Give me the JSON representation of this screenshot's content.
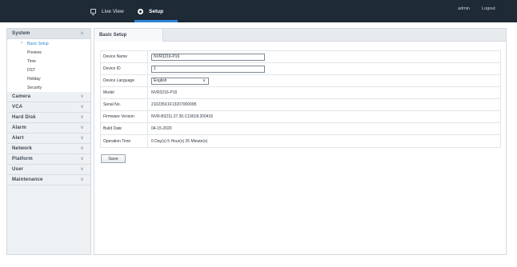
{
  "topbar": {
    "live_view_label": "Live View",
    "setup_label": "Setup",
    "admin_label": "admin",
    "logout_label": "Logout",
    "accent_color": "#2f86d8"
  },
  "sidebar": {
    "system_label": "System",
    "system_subitems": [
      "Basic Setup",
      "Preview",
      "Time",
      "DST",
      "Holiday",
      "Security"
    ],
    "groups": [
      "Camera",
      "VCA",
      "Hard Disk",
      "Alarm",
      "Alert",
      "Network",
      "Platform",
      "User",
      "Maintenance"
    ]
  },
  "main": {
    "tab_label": "Basic Setup",
    "fields": {
      "device_name_label": "Device Name",
      "device_name_value": "NVR3216-P16",
      "device_id_label": "Device ID",
      "device_id_value": "1",
      "device_language_label": "Device Language",
      "device_language_value": "English",
      "model_label": "Model",
      "model_value": "NVR3216-P16",
      "serial_label": "Serial No.",
      "serial_value": "210235X1F13207000095",
      "firmware_label": "Firmware Version",
      "firmware_value": "NVR-B3211.27.30.C19018.200415",
      "build_date_label": "Build Date",
      "build_date_value": "04-15-2020",
      "operation_time_label": "Operation Time",
      "operation_time_value": "0 Day(s)  5 Hour(s)  25 Minute(s)"
    },
    "save_label": "Save"
  }
}
